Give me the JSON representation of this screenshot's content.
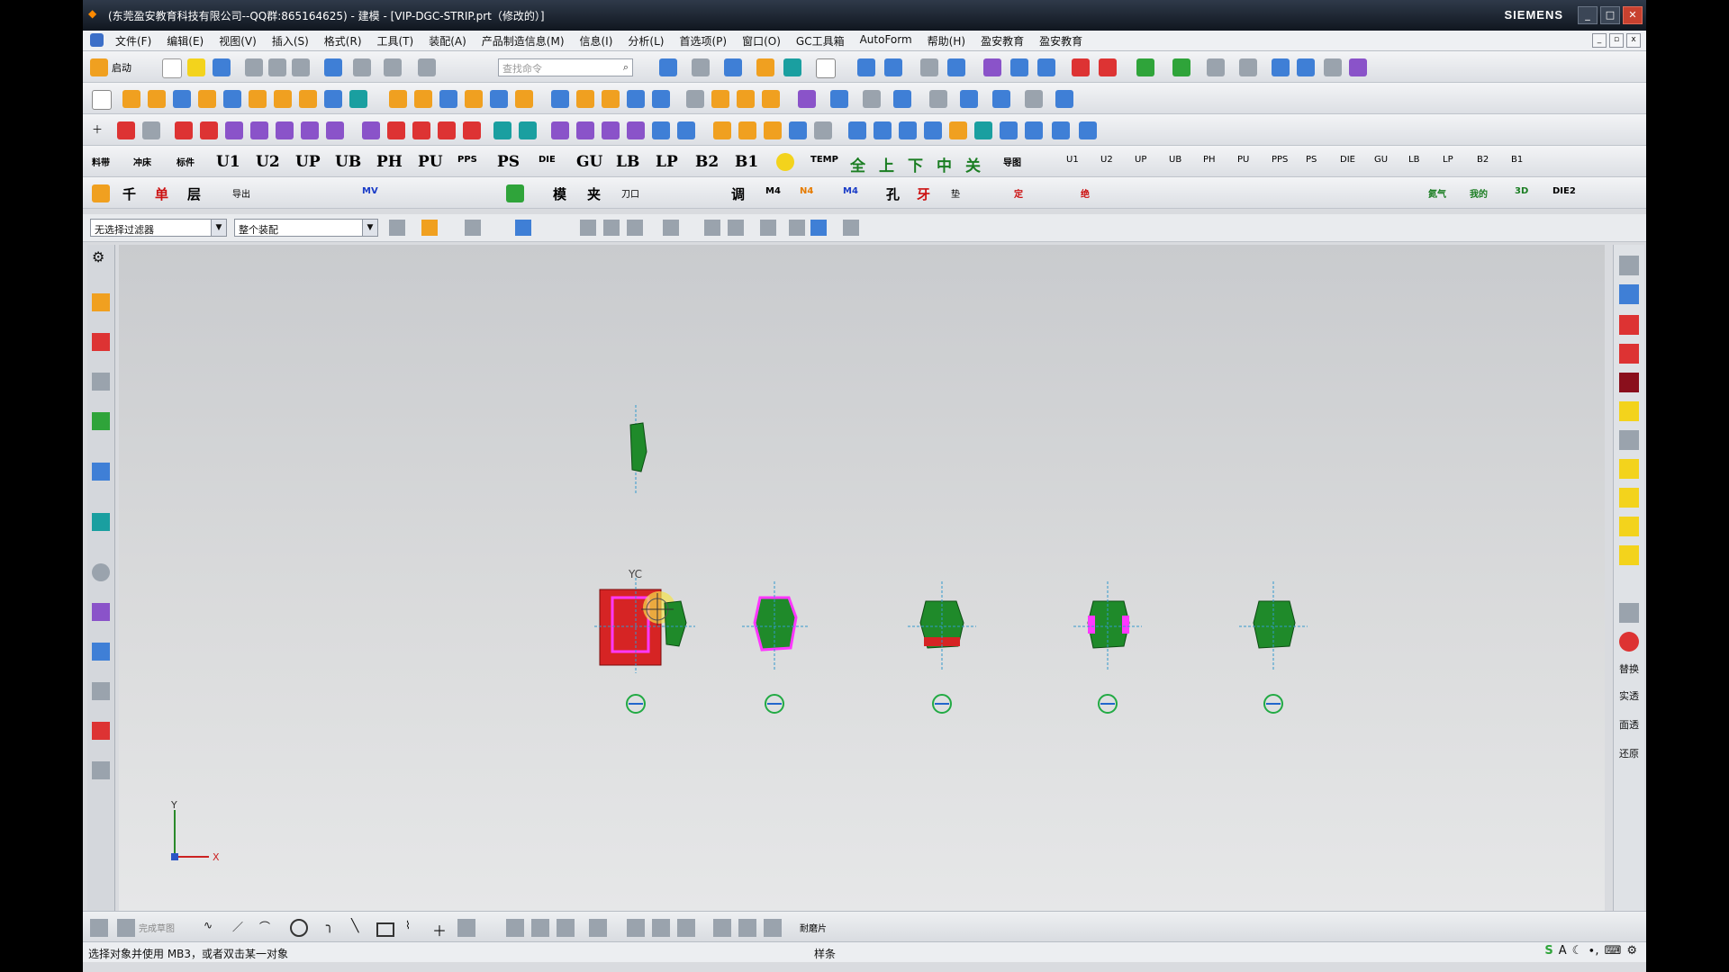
{
  "window": {
    "title": "(东莞盈安教育科技有限公司--QQ群:865164625) - 建模 - [VIP-DGC-STRIP.prt（修改的）]",
    "brand": "SIEMENS",
    "controls": [
      "_",
      "□",
      "✕"
    ]
  },
  "menu": {
    "items": [
      "文件(F)",
      "编辑(E)",
      "视图(V)",
      "插入(S)",
      "格式(R)",
      "工具(T)",
      "装配(A)",
      "产品制造信息(M)",
      "信息(I)",
      "分析(L)",
      "首选项(P)",
      "窗口(O)",
      "GC工具箱",
      "AutoForm",
      "帮助(H)",
      "盈安教育",
      "盈安教育"
    ]
  },
  "toolbar1": {
    "start_label": "启动",
    "search_placeholder": "查找命令"
  },
  "toolbar4": {
    "labels_left": [
      "料带",
      "冲床",
      "标件"
    ],
    "big_labels": [
      "U1",
      "U2",
      "UP",
      "UB",
      "PH",
      "PU",
      "PPS",
      "PS",
      "DIE",
      "GU",
      "LB",
      "LP",
      "B2",
      "B1"
    ],
    "small_labels": [
      "TEMP"
    ],
    "cn_labels": [
      "全",
      "上",
      "下",
      "中",
      "关"
    ],
    "nav_label": "导图",
    "right_labels": [
      "U1",
      "U2",
      "UP",
      "UB",
      "PH",
      "PU",
      "PPS",
      "PS",
      "DIE",
      "GU",
      "LB",
      "LP",
      "B2",
      "B1"
    ]
  },
  "toolbar5": {
    "labels": [
      "千",
      "单",
      "层",
      "导出",
      "MV",
      "模",
      "夹",
      "刀口",
      "调",
      "M4",
      "N4",
      "M4",
      "孔",
      "牙",
      "垫",
      "定",
      "绝",
      "氮气",
      "我的",
      "3D",
      "DIE2"
    ]
  },
  "filter": {
    "type_filter": "无选择过滤器",
    "scope": "整个装配"
  },
  "viewport": {
    "yc_label": "YC",
    "axis_x": "X",
    "axis_y": "Y"
  },
  "right_panel": {
    "labels": [
      "替换",
      "实透",
      "面透",
      "还原"
    ]
  },
  "bottom_toolbar": {
    "finish_sketch": "完成草图",
    "sheet_metal": "耐磨片"
  },
  "status": {
    "message": "选择对象并使用 MB3，或者双击某一对象",
    "middle": "样条"
  }
}
